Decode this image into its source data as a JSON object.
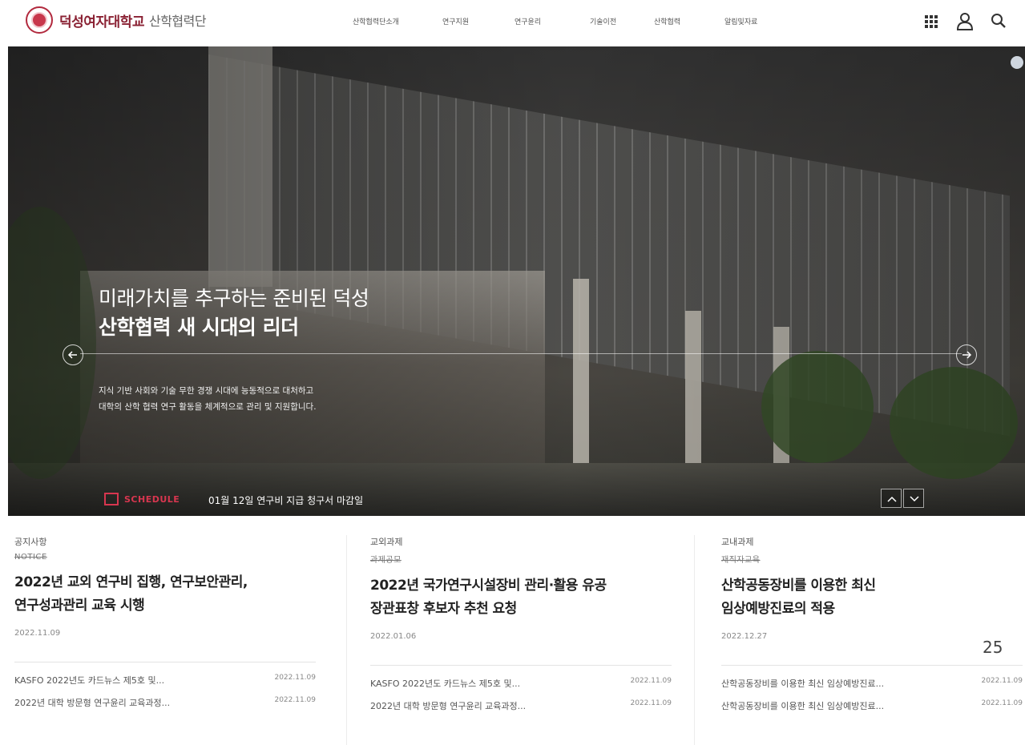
{
  "header": {
    "logo_name": "덕성여자대학교",
    "logo_sub": "산학협력단",
    "nav": [
      "산학협력단소개",
      "연구지원",
      "연구윤리",
      "기술이전",
      "산학협력",
      "알림및자료"
    ]
  },
  "utility_icons": [
    "grid-menu-icon",
    "user-icon",
    "search-icon"
  ],
  "hero": {
    "title_line1": "미래가치를 추구하는 준비된 덕성",
    "title_line2": "산학협력 새 시대의 리더",
    "desc_line1": "지식 기반 사회와 기술 무한 경쟁 시대에 능동적으로 대처하고",
    "desc_line2": "대학의 산학 협력 연구 활동을 체계적으로 관리 및 지원합니다.",
    "schedule_label": "SCHEDULE",
    "schedule_text": "01월 12일  연구비 지급 청구서 마감일"
  },
  "boards": [
    {
      "category": "공지사항",
      "sub": "NOTICE",
      "headline_1": "2022년 교외 연구비 집행, 연구보안관리,",
      "headline_2": "연구성과관리 교육 시행",
      "date": "2022.11.09",
      "items": [
        {
          "title": "KASFO 2022년도 카드뉴스 제5호 및...",
          "date": "2022.11.09"
        },
        {
          "title": "2022년 대학 방문형 연구윤리 교육과정...",
          "date": "2022.11.09"
        }
      ]
    },
    {
      "category": "교외과제",
      "sub": "과제공모",
      "headline_1": "2022년 국가연구시설장비 관리·활용 유공",
      "headline_2": "장관표창 후보자 추천 요청",
      "date": "2022.01.06",
      "items": [
        {
          "title": "KASFO 2022년도 카드뉴스 제5호 및...",
          "date": "2022.11.09"
        },
        {
          "title": "2022년 대학 방문형 연구윤리 교육과정...",
          "date": "2022.11.09"
        }
      ]
    },
    {
      "category": "교내과제",
      "sub": "재직자교육",
      "headline_1": "산학공동장비를 이용한 최신",
      "headline_2": "임상예방진료의 적용",
      "date": "2022.12.27",
      "items": [
        {
          "title": "산학공동장비를 이용한 최신 임상예방진료...",
          "date": "2022.11.09"
        },
        {
          "title": "산학공동장비를 이용한 최신 임상예방진료...",
          "date": "2022.11.09"
        }
      ]
    }
  ],
  "page_number": "25",
  "colors": {
    "brand": "#8a2133",
    "accent": "#d7364f"
  }
}
